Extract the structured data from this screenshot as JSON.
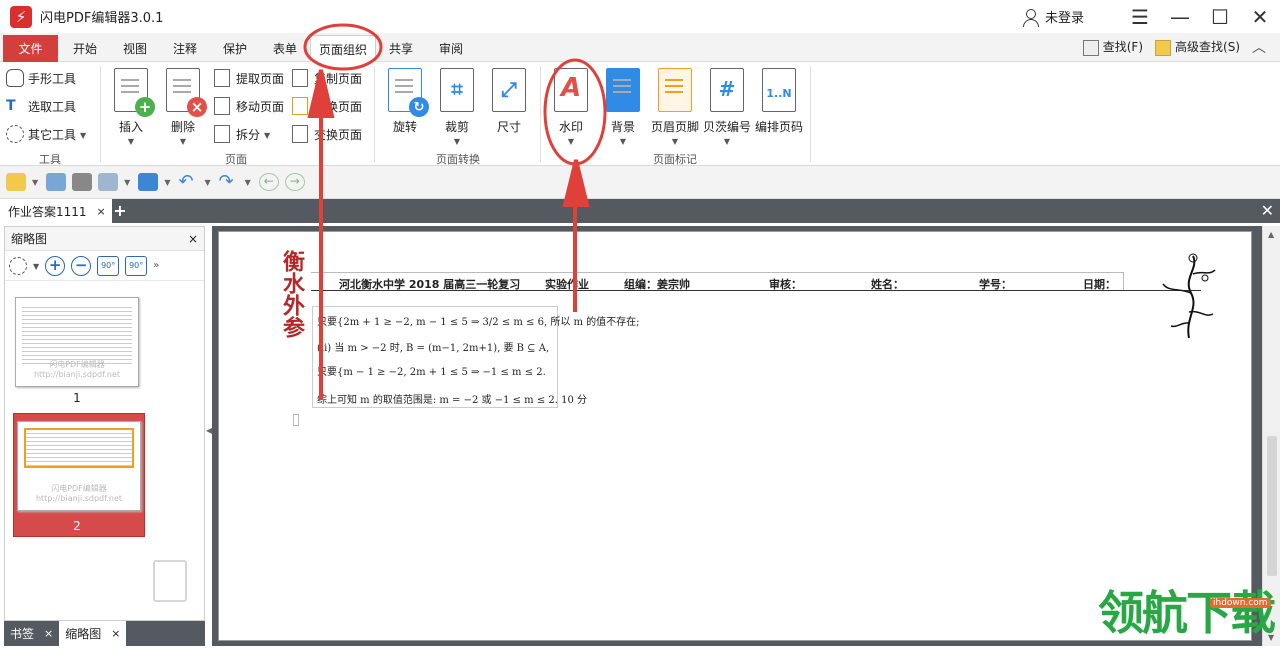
{
  "app": {
    "title": "闪电PDF编辑器3.0.1",
    "login": "未登录"
  },
  "window": {
    "menu_icon": "hamburger-icon",
    "min_icon": "minimize-icon",
    "max_icon": "maximize-icon",
    "close_icon": "close-icon"
  },
  "menu": {
    "file": "文件",
    "tabs": [
      "开始",
      "视图",
      "注释",
      "保护",
      "表单",
      "页面组织",
      "共享",
      "审阅"
    ],
    "active_tab": "页面组织",
    "find": "查找(F)",
    "advanced_find": "高级查找(S)"
  },
  "ribbon": {
    "tools": {
      "hand": "手形工具",
      "select": "选取工具",
      "other": "其它工具",
      "group": "工具"
    },
    "page": {
      "insert": "插入",
      "delete": "删除",
      "extract": "提取页面",
      "move": "移动页面",
      "split": "拆分",
      "copy": "复制页面",
      "replace": "替换页面",
      "swap": "交换页面",
      "group": "页面"
    },
    "convert": {
      "rotate": "旋转",
      "crop": "裁剪",
      "size": "尺寸",
      "group": "页面转换"
    },
    "mark": {
      "watermark": "水印",
      "background": "背景",
      "header_footer": "页眉页脚",
      "bates": "贝茨编号",
      "numbering": "编排页码",
      "group": "页面标记"
    },
    "numbering_glyph": "1..N",
    "bates_glyph": "#",
    "watermark_glyph": "A"
  },
  "colors": {
    "accent": "#d23f3c",
    "annotation": "#e0403a",
    "blue": "#2f8be6",
    "brand": "#27a845"
  },
  "document_tab": {
    "name": "作业答案1111",
    "close": "×",
    "new": "+"
  },
  "thumbnails": {
    "title": "缩略图",
    "close": "×",
    "rotate_left": "90°",
    "rotate_right": "90°",
    "pages": [
      {
        "number": "1",
        "watermark": "闪电PDF编辑器 http://bianji.sdpdf.net"
      },
      {
        "number": "2",
        "watermark": "闪电PDF编辑器 http://bianji.sdpdf.net"
      }
    ],
    "selected": "2"
  },
  "bottom_tabs": {
    "bookmarks": "书签",
    "thumbnails": "缩略图",
    "close": "×"
  },
  "page": {
    "seal_text": "衡水外参",
    "header": {
      "school": "河北衡水中学 2018 届高三一轮复习",
      "type": "实验作业",
      "editor": "组编：姜宗帅",
      "review": "审核：",
      "name": "姓名：",
      "student_id": "学号：",
      "date": "日期："
    },
    "formula_lines": [
      "只要{2m + 1 ≥ −2, m − 1 ≤ 5 ⇒ 3/2 ≤ m ≤ 6, 所以 m 的值不存在;",
      "(ii) 当 m > −2 时, B = (m−1, 2m+1), 要 B ⊆ A,",
      "只要{m − 1 ≥ −2, 2m + 1 ≤ 5 ⇒ −1 ≤ m ≤ 2.",
      "综上可知 m 的取值范围是: m = −2 或 −1 ≤ m ≤ 2.   10 分"
    ]
  },
  "brand": {
    "name": "领航下载",
    "url": "ihdown.com"
  }
}
